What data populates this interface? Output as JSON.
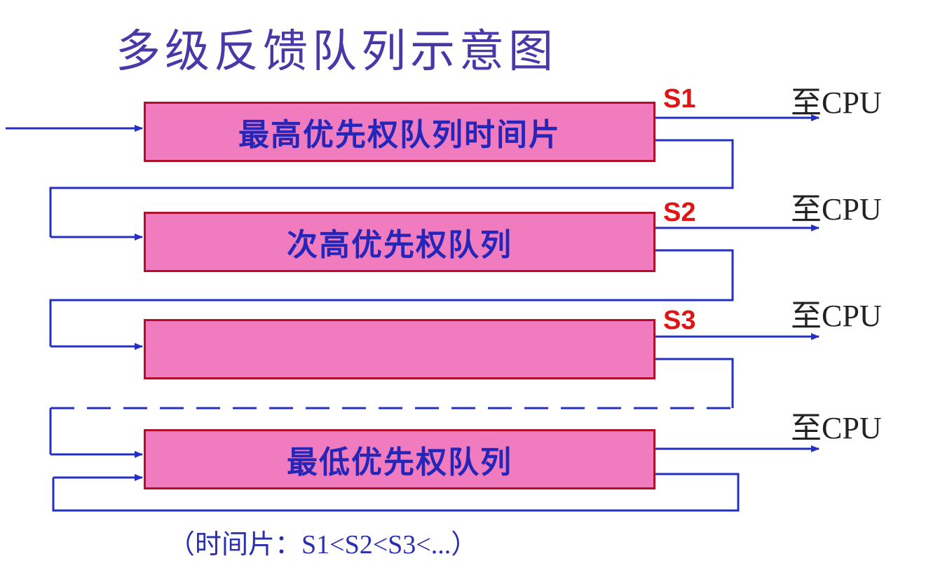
{
  "title": "多级反馈队列示意图",
  "queues": [
    {
      "label": "最高优先权队列时间片",
      "slice": "S1",
      "output": "至CPU"
    },
    {
      "label": "次高优先权队列",
      "slice": "S2",
      "output": "至CPU"
    },
    {
      "label": "",
      "slice": "S3",
      "output": "至CPU"
    },
    {
      "label": "最低优先权队列",
      "slice": "",
      "output": "至CPU"
    }
  ],
  "caption": "（时间片：S1<S2<S3<...）",
  "colors": {
    "wire": "#2530c0",
    "box_fill": "#f07cbf",
    "box_border": "#b0102c",
    "queue_text": "#2326b8",
    "slice_text": "#e01414",
    "title_text": "#4a38a8"
  }
}
